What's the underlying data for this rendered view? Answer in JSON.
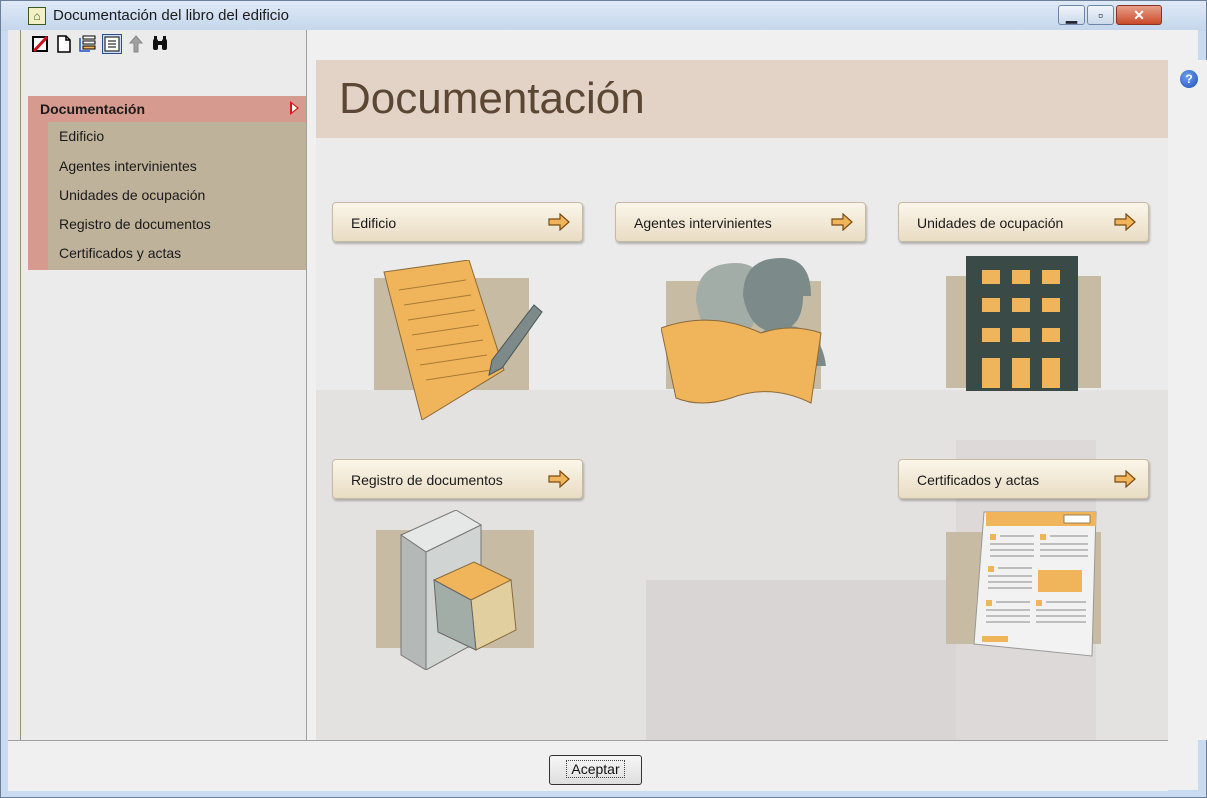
{
  "window": {
    "title": "Documentación del libro del edificio",
    "app_icon": "building-book-icon",
    "controls": [
      "minimize-icon",
      "maximize-icon",
      "close-icon"
    ]
  },
  "toolbar": {
    "icons": [
      "delete-icon",
      "new-document-icon",
      "list-icon",
      "view-details-icon",
      "up-arrow-icon",
      "binoculars-icon"
    ],
    "pressed": "view-details-icon"
  },
  "tree": {
    "root_label": "Documentación",
    "items": [
      {
        "label": "Edificio"
      },
      {
        "label": "Agentes intervinientes"
      },
      {
        "label": "Unidades de ocupación"
      },
      {
        "label": "Registro de documentos"
      },
      {
        "label": "Certificados y actas"
      }
    ]
  },
  "main": {
    "title": "Documentación",
    "buttons": [
      {
        "label": "Edificio",
        "icon": "right-arrow-icon",
        "illustration": "document-pen-icon"
      },
      {
        "label": "Agentes intervinientes",
        "icon": "right-arrow-icon",
        "illustration": "workers-plan-icon"
      },
      {
        "label": "Unidades de ocupación",
        "icon": "right-arrow-icon",
        "illustration": "building-icon"
      },
      {
        "label": "Registro de documentos",
        "icon": "right-arrow-icon",
        "illustration": "filing-cabinet-icon"
      },
      {
        "label": "Certificados y actas",
        "icon": "right-arrow-icon",
        "illustration": "certificate-document-icon"
      }
    ]
  },
  "help_icon": "help-icon",
  "footer": {
    "accept_label": "Aceptar"
  },
  "colors": {
    "accent_header": "#e2d3c6",
    "tree_selected": "#d79a8e",
    "tree_body": "#bfb29b",
    "illustration_orange": "#f0b55a",
    "title_brown": "#5b4734"
  }
}
